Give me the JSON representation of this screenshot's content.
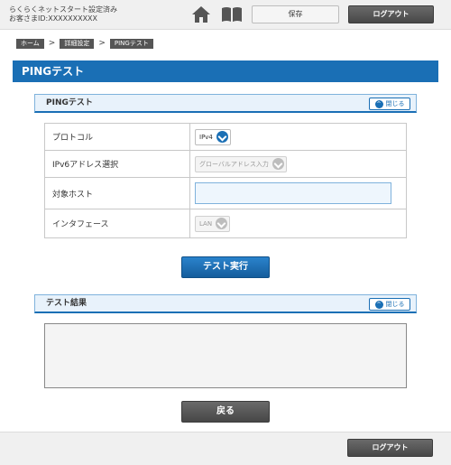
{
  "header": {
    "status_line1": "らくらくネットスタート設定済み",
    "status_line2": "お客さまID:XXXXXXXXXX",
    "save_label": "保存",
    "logout_label": "ログアウト"
  },
  "breadcrumb": [
    "ホーム",
    "詳細設定",
    "PINGテスト"
  ],
  "page_title": "PINGテスト",
  "ping_section": {
    "title": "PINGテスト",
    "close_label": "閉じる",
    "rows": {
      "protocol_label": "プロトコル",
      "protocol_value": "IPv4",
      "ipv6_label": "IPv6アドレス選択",
      "ipv6_value": "グローバルアドレス入力",
      "host_label": "対象ホスト",
      "host_value": "",
      "interface_label": "インタフェース",
      "interface_value": "LAN"
    }
  },
  "run_label": "テスト実行",
  "result_section": {
    "title": "テスト結果",
    "close_label": "閉じる",
    "output": ""
  },
  "back_label": "戻る",
  "footer": {
    "logout_label": "ログアウト"
  },
  "colors": {
    "accent": "#1a6fb5",
    "dark_button": "#4f4f4f",
    "header_bg": "#f0f0f0"
  }
}
